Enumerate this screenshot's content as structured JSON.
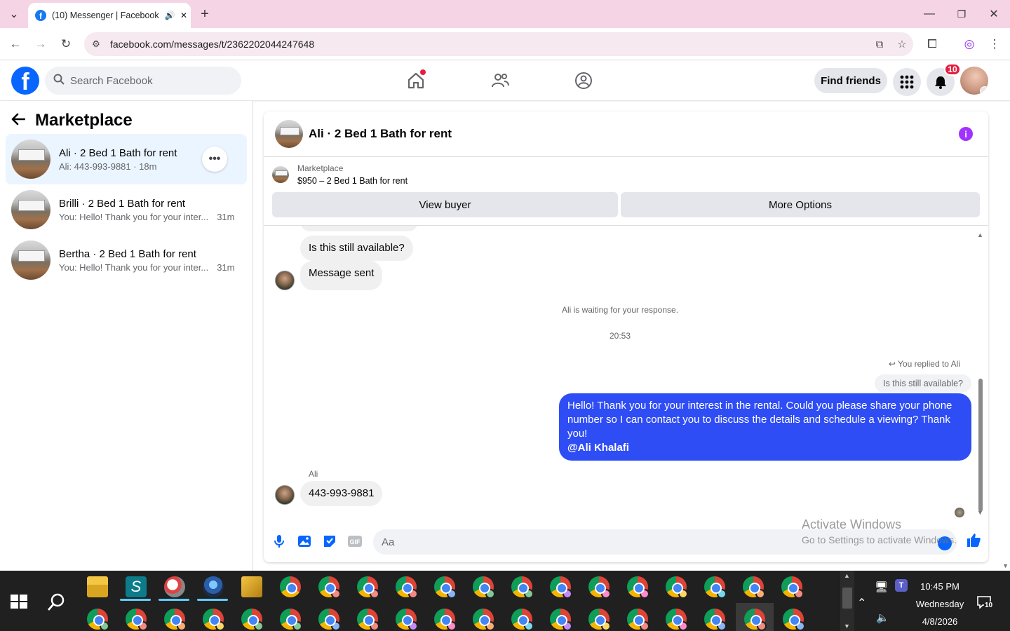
{
  "browser": {
    "tab_title": "(10) Messenger | Facebook",
    "favicon_letter": "f",
    "url": "facebook.com/messages/t/2362202044247648"
  },
  "fb": {
    "logo_letter": "f",
    "search_placeholder": "Search Facebook",
    "find_friends": "Find friends",
    "notif_count": "10"
  },
  "left": {
    "title": "Marketplace",
    "conversations": [
      {
        "name": "Ali · 2 Bed 1 Bath for rent",
        "preview": "Ali: 443-993-9881 · 18m",
        "time": ""
      },
      {
        "name": "Brilli · 2 Bed 1 Bath for rent",
        "preview": "You: Hello! Thank you for your inter...",
        "time": "31m"
      },
      {
        "name": "Bertha · 2 Bed 1 Bath for rent",
        "preview": "You: Hello! Thank you for your inter...",
        "time": "31m"
      }
    ],
    "more_glyph": "•••"
  },
  "chat": {
    "title": "Ali · 2 Bed 1 Bath for rent",
    "info_glyph": "i",
    "listing_label": "Marketplace",
    "listing_detail": "$950 – 2 Bed 1 Bath for rent",
    "view_buyer": "View buyer",
    "more_options": "More Options",
    "messages": {
      "m1": "Is this still available?",
      "m2": "Message sent",
      "waiting": "Ali is waiting for your response.",
      "time": "20:53",
      "replied": "You replied to Ali",
      "quote": "Is this still available?",
      "reply_body": "Hello! Thank you for your interest in the rental. Could you please share your phone number so I can contact you to discuss the details and schedule a viewing? Thank you!",
      "reply_mention": "@Ali Khalafi",
      "sender": "Ali",
      "m3": "443-993-9881"
    },
    "composer_placeholder": "Aa"
  },
  "watermark": {
    "line1": "Activate Windows",
    "line2": "Go to Settings to activate Windows."
  },
  "taskbar": {
    "time": "10:45 PM",
    "day": "Wednesday",
    "date": "4/8/2026",
    "notif_count": "10"
  },
  "colors": {
    "accent": "#0866ff",
    "bubble_blue": "#2f4df5",
    "badge_red": "#e41e3f",
    "tab_strip": "#f5d4e6"
  }
}
